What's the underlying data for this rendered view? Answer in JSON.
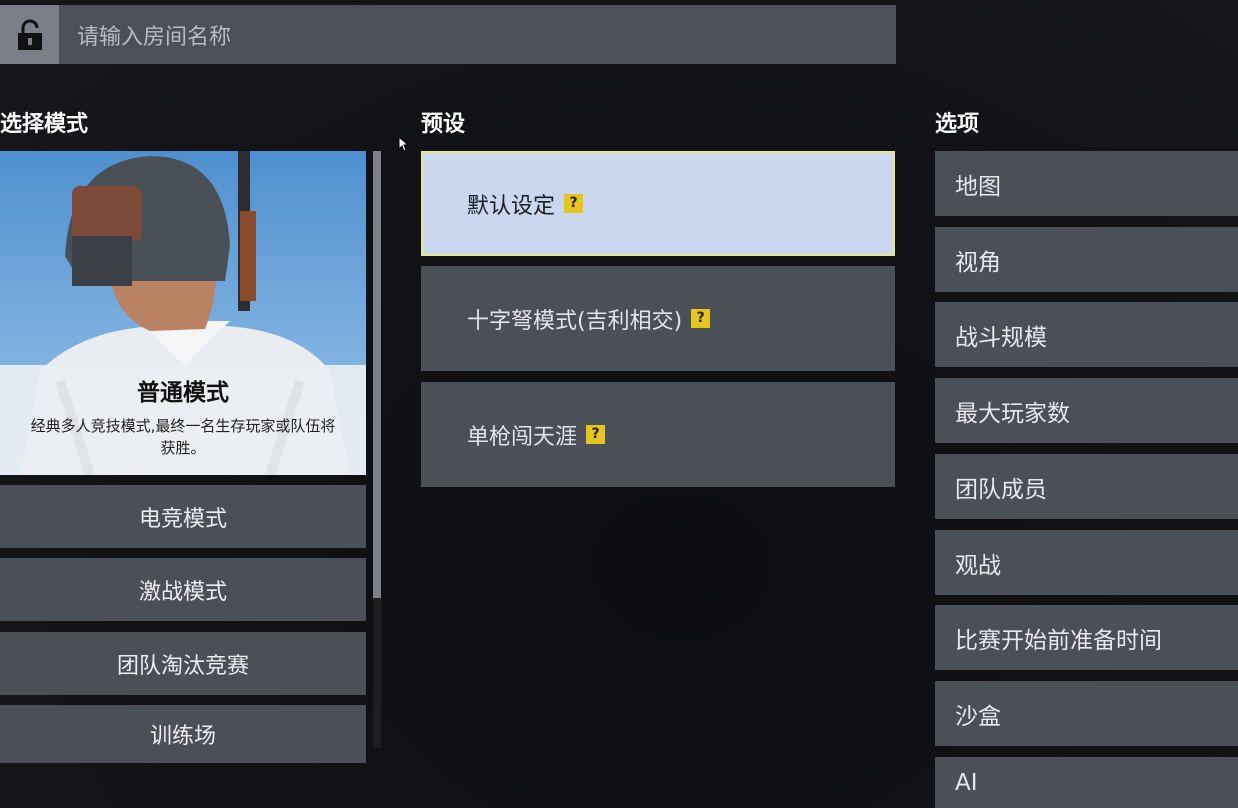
{
  "room": {
    "placeholder": "请输入房间名称",
    "lock_icon": "unlock-icon"
  },
  "headings": {
    "mode": "选择模式",
    "preset": "预设",
    "options": "选项"
  },
  "mode_card": {
    "title": "普通模式",
    "desc": "经典多人竞技模式,最终一名生存玩家或队伍将获胜。"
  },
  "modes": [
    "电竞模式",
    "激战模式",
    "团队淘汰竞赛",
    "训练场"
  ],
  "presets": [
    {
      "label": "默认设定",
      "help": "?"
    },
    {
      "label": "十字弩模式(吉利相交)",
      "help": "?"
    },
    {
      "label": "单枪闯天涯",
      "help": "?"
    }
  ],
  "options": [
    "地图",
    "视角",
    "战斗规模",
    "最大玩家数",
    "团队成员",
    "观战",
    "比赛开始前准备时间",
    "沙盒",
    "AI"
  ],
  "colors": {
    "selected_preset": "#cbd7ef",
    "help_badge": "#e7c51f",
    "tile": "#4b4f56"
  }
}
